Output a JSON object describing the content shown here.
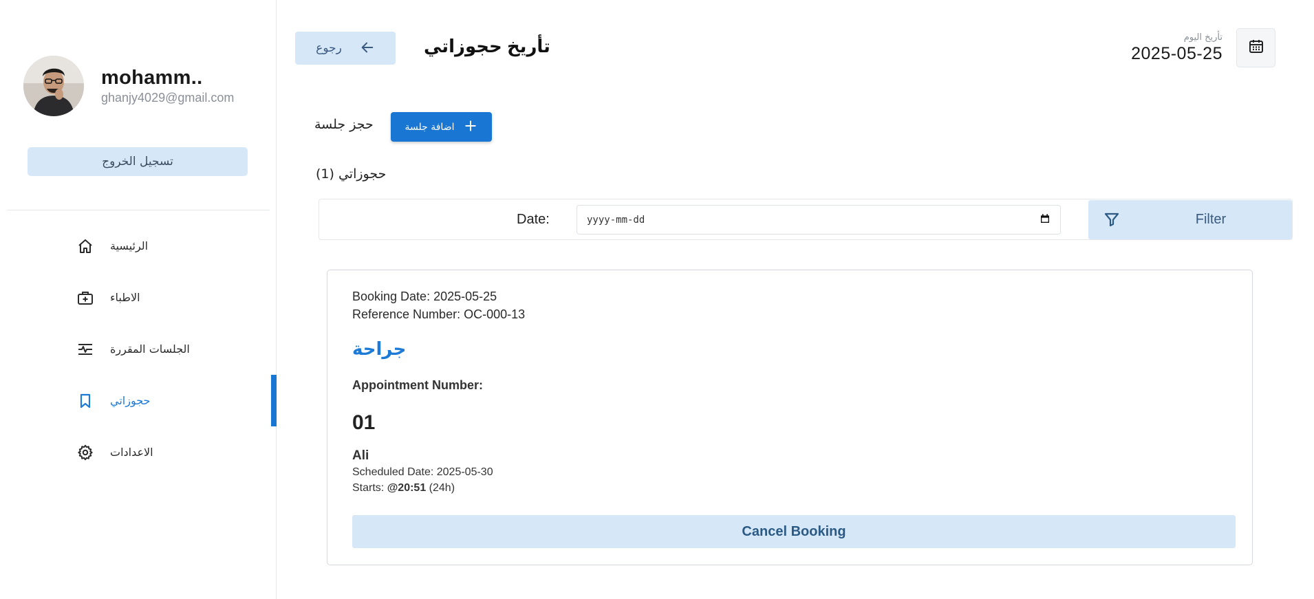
{
  "profile": {
    "name": "mohamm..",
    "email": "ghanjy4029@gmail.com",
    "logout_label": "تسجيل الخروج"
  },
  "nav": {
    "items": [
      {
        "label": "الرئيسية",
        "icon": "home-icon"
      },
      {
        "label": "الاطباء",
        "icon": "medical-bag-icon"
      },
      {
        "label": "الجلسات المقررة",
        "icon": "vital-signs-icon"
      },
      {
        "label": "حجوزاتي",
        "icon": "bookmark-icon",
        "active": true
      },
      {
        "label": "الاعدادات",
        "icon": "gear-icon"
      }
    ]
  },
  "header": {
    "back_label": "رجوع",
    "title": "تأريخ حجوزاتي",
    "today_label": "تأريخ اليوم",
    "today_date": "2025-05-25"
  },
  "booking": {
    "section_label": "حجز جلسة",
    "add_label": "اضافة جلسة",
    "count_label": "حجوزاتي (1)"
  },
  "filter": {
    "date_label": "Date:",
    "date_placeholder": "yyyy-mm-dd",
    "button_label": "Filter"
  },
  "card": {
    "booking_date": "Booking Date: 2025-05-25",
    "reference": "Reference Number: OC-000-13",
    "specialty": "جراحة",
    "appointment_label": "Appointment Number:",
    "appointment_number": "01",
    "doctor": "Ali",
    "scheduled": "Scheduled Date: 2025-05-30",
    "starts_prefix": "Starts: ",
    "starts_time": "@20:51",
    "starts_suffix": " (24h)",
    "cancel_label": "Cancel Booking"
  },
  "colors": {
    "accent": "#1976d2",
    "light_accent": "#d6e8f7"
  }
}
